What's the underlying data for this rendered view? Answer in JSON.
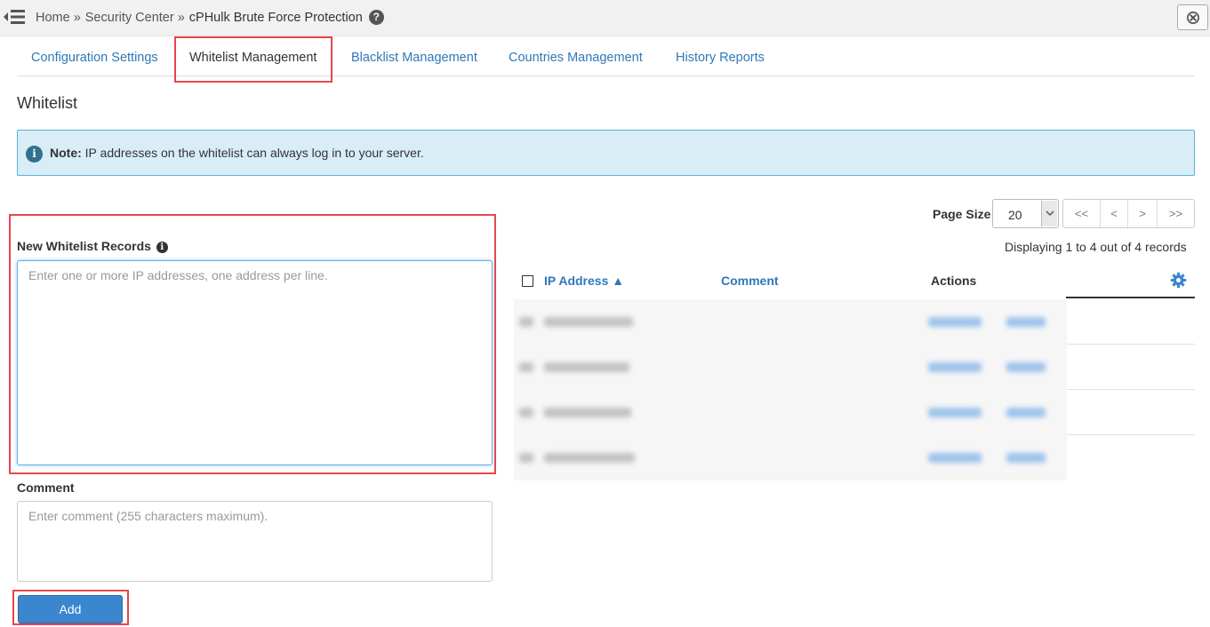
{
  "breadcrumb": {
    "items": [
      "Home",
      "Security Center",
      "cPHulk Brute Force Protection"
    ],
    "separator": "»"
  },
  "tabs": [
    {
      "label": "Configuration Settings",
      "active": false
    },
    {
      "label": "Whitelist Management",
      "active": true
    },
    {
      "label": "Blacklist Management",
      "active": false
    },
    {
      "label": "Countries Management",
      "active": false
    },
    {
      "label": "History Reports",
      "active": false
    }
  ],
  "section": {
    "title": "Whitelist"
  },
  "note": {
    "label": "Note:",
    "text": "IP addresses on the whitelist can always log in to your server."
  },
  "form": {
    "records_label": "New Whitelist Records",
    "records_placeholder": "Enter one or more IP addresses, one address per line.",
    "comment_label": "Comment",
    "comment_placeholder": "Enter comment (255 characters maximum).",
    "add_label": "Add"
  },
  "table": {
    "page_size_label": "Page Size",
    "page_size_value": "20",
    "pager": [
      "<<",
      "<",
      ">",
      ">>"
    ],
    "records_info": "Displaying 1 to 4 out of 4 records",
    "columns": {
      "ip": "IP Address ▲",
      "comment": "Comment",
      "actions": "Actions"
    },
    "row_count": 4
  },
  "colors": {
    "link": "#2f78b7",
    "highlight": "#e8464c",
    "note_bg": "#d9edf7",
    "button": "#3a87cf"
  },
  "icons": [
    "menu-toggle-icon",
    "help-icon",
    "close-icon",
    "info-icon",
    "gear-icon",
    "chevron-down-icon"
  ]
}
